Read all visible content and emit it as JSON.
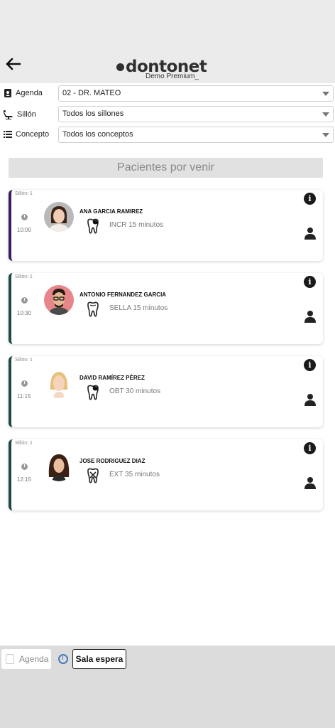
{
  "header": {
    "logo_text": "dontonet",
    "logo_subtitle": "Demo Premium_"
  },
  "filters": {
    "agenda_label": "Agenda",
    "agenda_value": "02 - DR. MATEO",
    "sillon_label": "Sillón",
    "sillon_value": "Todos los sillones",
    "concepto_label": "Concepto",
    "concepto_value": "Todos los conceptos"
  },
  "section_title": "Pacientes por venir",
  "patients": [
    {
      "chair": "Sillón: 1",
      "time": "10:00",
      "name": "ANA GARCIA RAMIREZ",
      "treatment": "INCR 15 minutos",
      "accent": "#3a1f5c",
      "avatar_bg": "#b9b9b9",
      "tooth_type": "filled"
    },
    {
      "chair": "Sillón: 1",
      "time": "10:30",
      "name": "ANTONIO FERNANDEZ GARCIA",
      "treatment": "SELLA 15 minutos",
      "accent": "#1e4a46",
      "avatar_bg": "#e7868a",
      "tooth_type": "outline"
    },
    {
      "chair": "Sillón: 1",
      "time": "11:15",
      "name": "DAVID RAMÍREZ PÉREZ",
      "treatment": "OBT 30 minutos",
      "accent": "#1e4a46",
      "avatar_bg": "#ffffff",
      "tooth_type": "filled"
    },
    {
      "chair": "Sillón: 1",
      "time": "12:15",
      "name": "JOSE RODRIGUEZ DIAZ",
      "treatment": "EXT 35 minutos",
      "accent": "#1e4a46",
      "avatar_bg": "#ffffff",
      "tooth_type": "extraction"
    }
  ],
  "bottom_nav": {
    "agenda_label": "Agenda",
    "espera_label": "Sala espera"
  }
}
